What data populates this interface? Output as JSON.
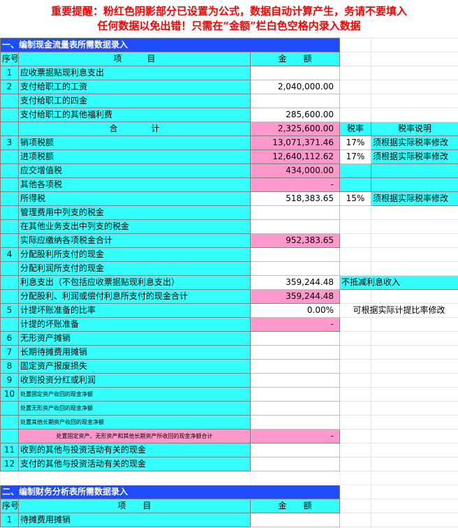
{
  "notice": {
    "line1": "重要提醒：粉红色阴影部分已设置为公式，数据自动计算产生，务请不要填入",
    "line2": "任何数据以免出错！只需在“金额”栏白色空格内录入数据"
  },
  "section1": {
    "title": "一、编制现金流量表所需数据录入",
    "header": {
      "seq": "序号",
      "item": "项　　　目",
      "amount": "金　　额"
    },
    "tax_header": {
      "rate": "税率",
      "note": "税率说明"
    },
    "rows": [
      {
        "seq": "1",
        "item": "应收票据贴现利息支出",
        "amount": ""
      },
      {
        "seq": "2",
        "item": "支付给职工的工资",
        "amount": "2,040,000.00"
      },
      {
        "seq": "",
        "item": "支付给职工的四金",
        "amount": ""
      },
      {
        "seq": "",
        "item": "支付给职工的其他福利费",
        "amount": "285,600.00"
      },
      {
        "seq": "",
        "item": "合　　　　计",
        "amount": "2,325,600.00"
      },
      {
        "seq": "3",
        "item": "销项税额",
        "amount": "13,071,371.46",
        "rate": "17%",
        "note": "须根据实际税率修改"
      },
      {
        "seq": "",
        "item": "进项税额",
        "amount": "12,640,112.62",
        "rate": "17%",
        "note": "须根据实际税率修改"
      },
      {
        "seq": "",
        "item": "应交增值税",
        "amount": "434,000.00"
      },
      {
        "seq": "",
        "item": "其他各项税",
        "amount": "-"
      },
      {
        "seq": "",
        "item": "所得税",
        "amount": "518,383.65",
        "rate": "15%",
        "note": "须根据实际税率修改"
      },
      {
        "seq": "",
        "item": "管理费用中列支的税金",
        "amount": ""
      },
      {
        "seq": "",
        "item": "在其他业务支出中列支的税金",
        "amount": ""
      },
      {
        "seq": "",
        "item": "实际应缴纳各项税金合计",
        "amount": "952,383.65"
      },
      {
        "seq": "4",
        "item": "分配股利所支付的现金",
        "amount": ""
      },
      {
        "seq": "",
        "item": "分配利润所支付的现金",
        "amount": ""
      },
      {
        "seq": "",
        "item": "利息支出（不包括应收票据贴现利息支出）",
        "amount": "359,244.48",
        "note": "不抵减利息收入"
      },
      {
        "seq": "",
        "item": "分配股利、利润或偿付利息所支付的现金合计",
        "amount": "359,244.48"
      },
      {
        "seq": "5",
        "item": "计提坏账准备的比率",
        "amount": "0.00%",
        "note": "可根据实际计提比率修改"
      },
      {
        "seq": "",
        "item": "计提的坏账准备",
        "amount": "-"
      },
      {
        "seq": "6",
        "item": "无形资产摊销",
        "amount": ""
      },
      {
        "seq": "7",
        "item": "长期待摊费用摊销",
        "amount": ""
      },
      {
        "seq": "8",
        "item": "固定资产报废损失",
        "amount": ""
      },
      {
        "seq": "9",
        "item": "收到投资分红或利润",
        "amount": ""
      },
      {
        "seq": "10",
        "item": "处置固定资产收回的现金净额",
        "amount": ""
      },
      {
        "seq": "",
        "item": "处置无形资产收回的现金净额",
        "amount": ""
      },
      {
        "seq": "",
        "item": "处置其他长期资产收回的现金净额",
        "amount": ""
      },
      {
        "seq": "",
        "item": "处置固定资产、无形资产和其他长期资产所收回的现金净额合计",
        "amount": "-"
      },
      {
        "seq": "11",
        "item": "收到的其他与投资活动有关的现金",
        "amount": ""
      },
      {
        "seq": "12",
        "item": "支付的其他与投资活动有关的现金",
        "amount": ""
      }
    ]
  },
  "section2": {
    "title": "二、编制财务分析表所需数据录入",
    "header": {
      "seq": "序号",
      "item": "项　　目",
      "amount": "金　　额"
    },
    "rows": [
      {
        "seq": "1",
        "item": "待摊费用摊销",
        "amount": ""
      }
    ]
  },
  "colors": {
    "cyan": "#33ffff",
    "pink": "#ff99cc",
    "section_blue": "#1f4cff",
    "notice_red": "#ff0000"
  }
}
